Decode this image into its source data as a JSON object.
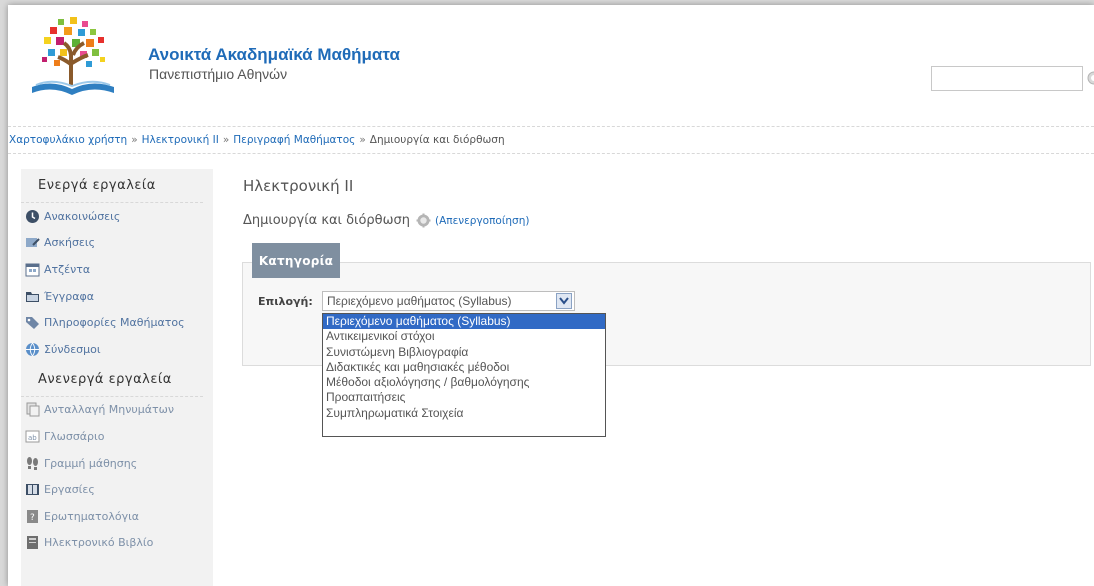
{
  "header": {
    "site_title": "Ανοικτά Ακαδημαϊκά Μαθήματα",
    "site_subtitle": "Πανεπιστήμιο Αθηνών",
    "search": {
      "value": "",
      "placeholder": ""
    }
  },
  "breadcrumb": {
    "items": [
      "Χαρτοφυλάκιο χρήστη",
      "Ηλεκτρονική ΙΙ",
      "Περιγραφή Μαθήματος",
      "Δημιουργία και διόρθωση"
    ],
    "separator": "»"
  },
  "sidebar": {
    "active_heading": "Ενεργά εργαλεία",
    "active_items": [
      {
        "label": "Ανακοινώσεις",
        "icon": "announcements-icon"
      },
      {
        "label": "Ασκήσεις",
        "icon": "exercises-icon"
      },
      {
        "label": "Ατζέντα",
        "icon": "calendar-icon"
      },
      {
        "label": "Έγγραφα",
        "icon": "folder-icon"
      },
      {
        "label": "Πληροφορίες Μαθήματος",
        "icon": "tag-icon"
      },
      {
        "label": "Σύνδεσμοι",
        "icon": "globe-icon"
      }
    ],
    "inactive_heading": "Ανενεργά εργαλεία",
    "inactive_items": [
      {
        "label": "Ανταλλαγή Μηνυμάτων",
        "icon": "messages-icon"
      },
      {
        "label": "Γλωσσάριο",
        "icon": "glossary-icon"
      },
      {
        "label": "Γραμμή μάθησης",
        "icon": "footprints-icon"
      },
      {
        "label": "Εργασίες",
        "icon": "book-icon"
      },
      {
        "label": "Ερωτηματολόγια",
        "icon": "questionnaire-icon"
      },
      {
        "label": "Ηλεκτρονικό Βιβλίο",
        "icon": "ebook-icon"
      }
    ]
  },
  "main": {
    "course_title": "Ηλεκτρονική ΙΙ",
    "subtitle": "Δημιουργία και διόρθωση",
    "deactivate_label": "(Απενεργοποίηση)",
    "legend": "Κατηγορία",
    "field_label": "Επιλογή:",
    "selected_value": "Περιεχόμενο μαθήματος (Syllabus)",
    "options": [
      "Περιεχόμενο μαθήματος (Syllabus)",
      "Αντικειμενικοί στόχοι",
      "Συνιστώμενη Βιβλιογραφία",
      "Διδακτικές και μαθησιακές μέθοδοι",
      "Μέθοδοι αξιολόγησης / βαθμολόγησης",
      "Προαπαιτήσεις",
      "Συμπληρωματικά Στοιχεία"
    ]
  },
  "colors": {
    "link": "#1f6bb8",
    "legend_bg": "#7f8fa0",
    "selected_option": "#316ac5",
    "sidebar_bg": "#f2f2f2"
  }
}
